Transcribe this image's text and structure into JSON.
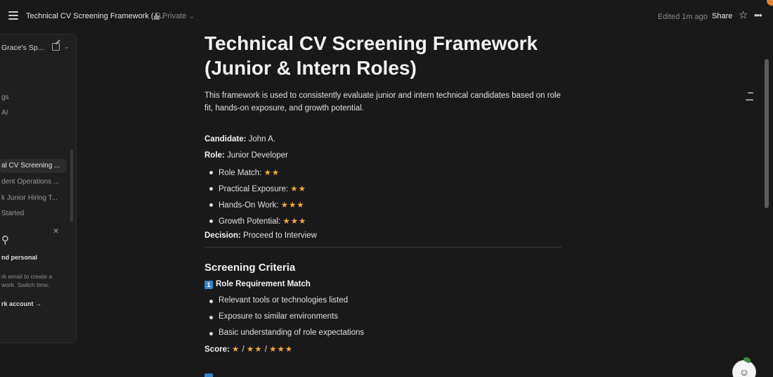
{
  "topbar": {
    "page_title": "Technical CV Screening Framework (J...",
    "privacy": "Private",
    "edited": "Edited 1m ago",
    "share_label": "Share",
    "icons": [
      "menu-icon",
      "lock-icon",
      "chevron-down-icon",
      "star-icon",
      "more-icon"
    ]
  },
  "sidebar": {
    "workspace_name": "Grace's Sp...",
    "items": [
      {
        "label": "gs"
      },
      {
        "label": "AI"
      },
      {
        "label": "al CV Screening ..."
      },
      {
        "label": "dent Operations ..."
      },
      {
        "label": "k Junior Hiring T..."
      },
      {
        "label": "Started"
      }
    ],
    "promo": {
      "title": "nd personal",
      "body": "rk email to create a work. Switch time.",
      "link": "rk account →"
    }
  },
  "doc": {
    "title": "Technical CV Screening Framework (Junior & Intern Roles)",
    "intro": "This framework is used to consistently evaluate junior and intern technical candidates based on role fit, hands-on exposure, and growth potential.",
    "candidate_label": "Candidate:",
    "candidate_value": "John A.",
    "role_label": "Role:",
    "role_value": "Junior Developer",
    "ratings": [
      {
        "label": "Role Match:",
        "stars": "★★"
      },
      {
        "label": "Practical Exposure:",
        "stars": "★★"
      },
      {
        "label": "Hands-On Work:",
        "stars": "★★★"
      },
      {
        "label": "Growth Potential:",
        "stars": "★★★"
      }
    ],
    "decision_label": "Decision:",
    "decision_value": "Proceed to Interview",
    "section_heading": "Screening Criteria",
    "criterion_number": "1",
    "criterion_title": "Role Requirement Match",
    "criterion_bullets": [
      "Relevant tools or technologies listed",
      "Exposure to similar environments",
      "Basic understanding of role expectations"
    ],
    "score_label": "Score:",
    "score_1": "★",
    "score_sep_1": "/",
    "score_2": "★★",
    "score_sep_2": "/",
    "score_3": "★★★"
  },
  "colors": {
    "background": "#191919",
    "star": "#f3a93b",
    "keycap_badge": "#3b82c4",
    "profile_dot": "#e9802c"
  }
}
